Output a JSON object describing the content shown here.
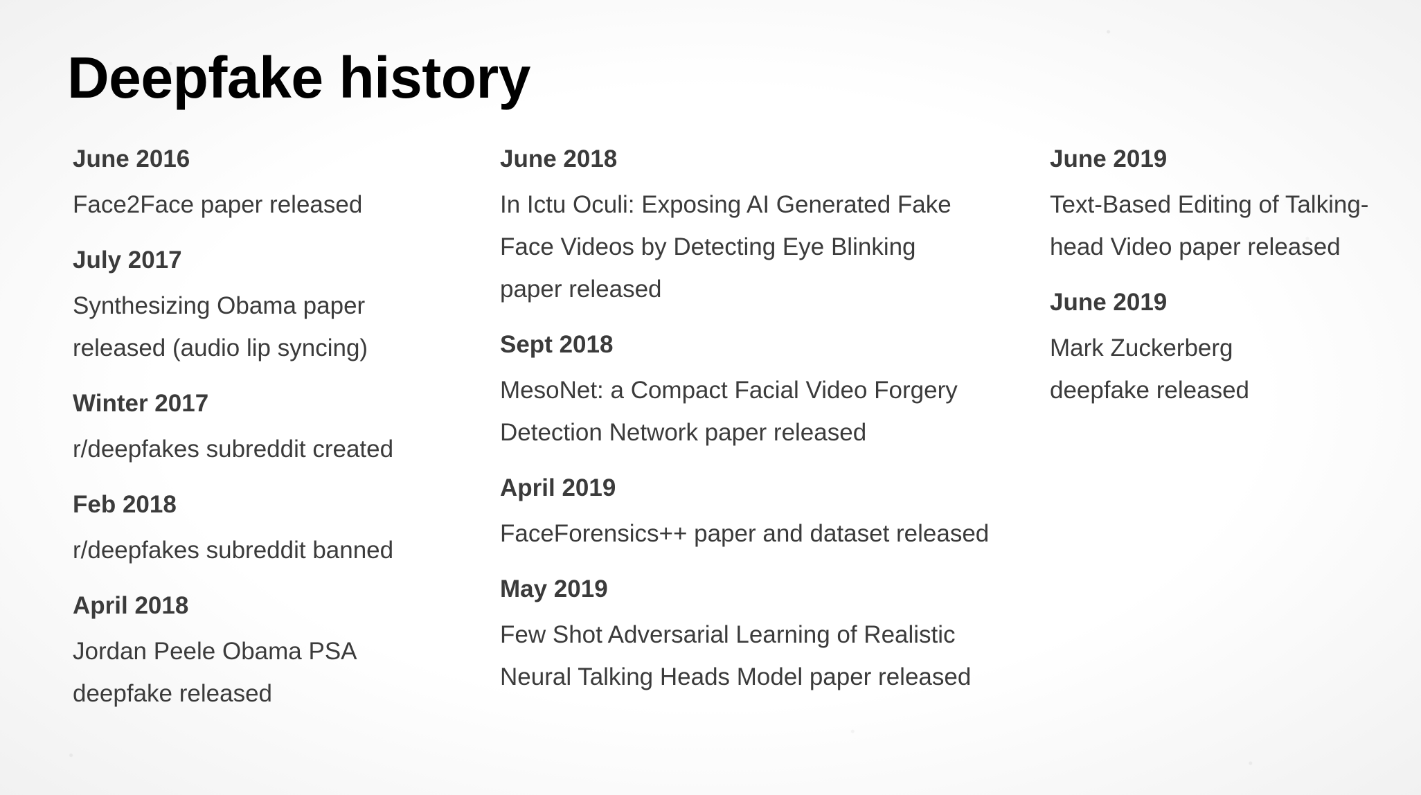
{
  "title": "Deepfake history",
  "columns": [
    {
      "entries": [
        {
          "date": "June 2016",
          "lines": [
            "Face2Face paper released"
          ]
        },
        {
          "date": "July 2017",
          "lines": [
            "Synthesizing Obama paper",
            "released (audio lip syncing)"
          ]
        },
        {
          "date": "Winter 2017",
          "lines": [
            "r/deepfakes subreddit created"
          ]
        },
        {
          "date": "Feb 2018",
          "lines": [
            "r/deepfakes subreddit banned"
          ]
        },
        {
          "date": "April 2018",
          "lines": [
            "Jordan Peele Obama PSA",
            "deepfake released"
          ]
        }
      ]
    },
    {
      "entries": [
        {
          "date": "June 2018",
          "lines": [
            "In Ictu Oculi: Exposing AI Generated Fake",
            "Face Videos by Detecting Eye Blinking",
            "paper released"
          ]
        },
        {
          "date": "Sept 2018",
          "lines": [
            "MesoNet: a Compact Facial Video Forgery",
            "Detection Network paper released"
          ]
        },
        {
          "date": "April 2019",
          "lines": [
            "FaceForensics++ paper and dataset released"
          ]
        },
        {
          "date": "May 2019",
          "lines": [
            "Few Shot Adversarial Learning of Realistic",
            "Neural Talking Heads Model paper released"
          ]
        }
      ]
    },
    {
      "entries": [
        {
          "date": "June 2019",
          "lines": [
            "Text-Based Editing of Talking-",
            "head Video paper released"
          ]
        },
        {
          "date": "June 2019",
          "lines": [
            "Mark Zuckerberg",
            "deepfake released"
          ]
        }
      ]
    }
  ]
}
